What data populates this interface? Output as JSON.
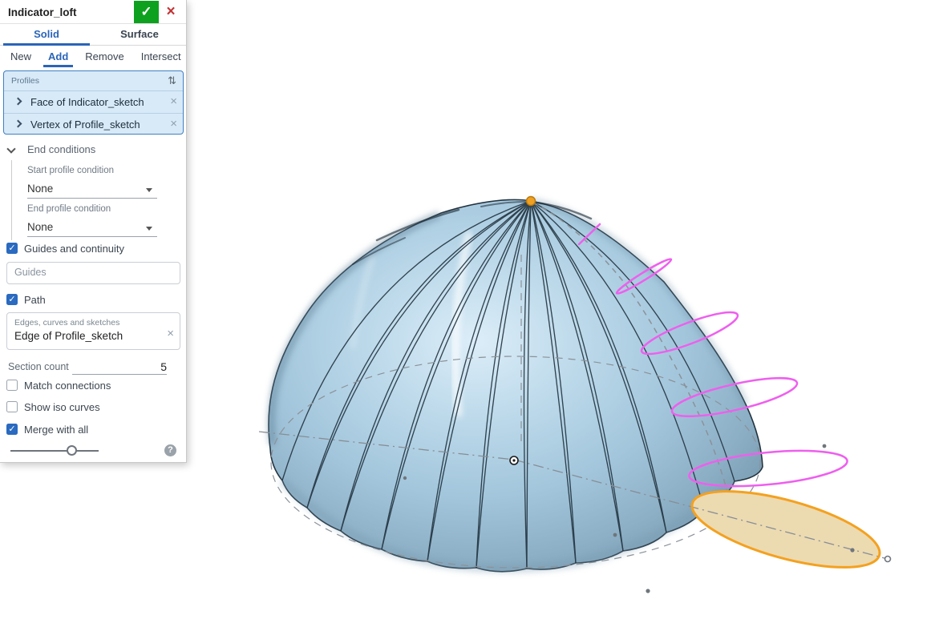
{
  "dialog": {
    "title_value": "Indicator_loft",
    "commit_glyph": "✓",
    "cancel_glyph": "×",
    "tabs": [
      {
        "label": "Solid",
        "active": true
      },
      {
        "label": "Surface",
        "active": false
      }
    ],
    "boolean_tabs": [
      {
        "label": "New",
        "active": false
      },
      {
        "label": "Add",
        "active": true
      },
      {
        "label": "Remove",
        "active": false
      },
      {
        "label": "Intersect",
        "active": false
      }
    ],
    "profiles": {
      "label": "Profiles",
      "sort_glyph": "⇅",
      "items": [
        {
          "label": "Face of Indicator_sketch",
          "remove_glyph": "×"
        },
        {
          "label": "Vertex of Profile_sketch",
          "remove_glyph": "×"
        }
      ]
    },
    "end_conditions": {
      "header": "End conditions",
      "start_label": "Start profile condition",
      "start_value": "None",
      "end_label": "End profile condition",
      "end_value": "None"
    },
    "guides_checkbox": {
      "label": "Guides and continuity",
      "checked": true,
      "check_glyph": "✓"
    },
    "guides_input": {
      "placeholder": "Guides"
    },
    "path_checkbox": {
      "label": "Path",
      "checked": true,
      "check_glyph": "✓"
    },
    "path_box": {
      "label": "Edges, curves and sketches",
      "value": "Edge of Profile_sketch",
      "remove_glyph": "×"
    },
    "section_count": {
      "label": "Section count",
      "value": "5"
    },
    "match_connections_checkbox": {
      "label": "Match connections",
      "checked": false
    },
    "show_iso_checkbox": {
      "label": "Show iso curves",
      "checked": false
    },
    "merge_checkbox": {
      "label": "Merge with all",
      "checked": true,
      "check_glyph": "✓"
    },
    "help_glyph": "?"
  },
  "colors": {
    "accent_blue": "#2a65b8",
    "checkbox_blue": "#2a6ac0",
    "commit_green": "#0ea11f",
    "cancel_red": "#c13333",
    "profiles_bg": "#d8eaf8",
    "profiles_border": "#3f7fc1",
    "dome_mid": "#a9cadf",
    "dome_edge": "#7598ae",
    "rib_stroke": "#22333f",
    "section_magenta": "#ee5fee",
    "path_dash_gray": "#8b9299",
    "sketch_orange": "#f4a11f",
    "sketch_fill_tan": "#ecdab1",
    "apex_vertex_orange": "#f0a122"
  }
}
